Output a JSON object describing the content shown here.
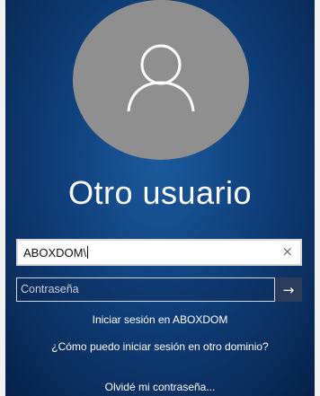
{
  "login": {
    "title": "Otro usuario",
    "username_value": "ABOXDOM\\",
    "password_placeholder": "Contraseña",
    "sign_in_domain_text": "Iniciar sesión en ABOXDOM",
    "other_domain_link": "¿Cómo puedo iniciar sesión en otro dominio?",
    "forgot_password_link": "Olvidé mi contraseña..."
  },
  "icons": {
    "avatar": "user-silhouette-icon",
    "clear": "close-icon",
    "submit": "arrow-right-icon"
  },
  "colors": {
    "background": "#0f3f7a",
    "avatar": "#8f8f8f",
    "submit_button": "#2a3c59"
  }
}
